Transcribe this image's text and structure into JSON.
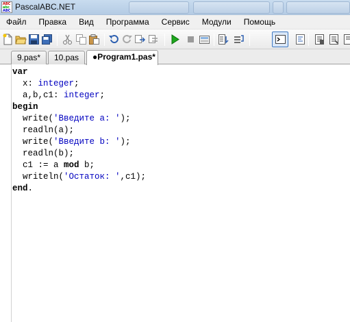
{
  "window": {
    "title": "PascalABC.NET",
    "icon_lines": [
      "ABC",
      "abc",
      "ABC"
    ]
  },
  "menu": [
    "Файл",
    "Правка",
    "Вид",
    "Программа",
    "Сервис",
    "Модули",
    "Помощь"
  ],
  "toolbar": {
    "buttons": [
      {
        "name": "new-file-icon"
      },
      {
        "name": "open-file-icon"
      },
      {
        "name": "save-icon"
      },
      {
        "name": "save-all-icon"
      },
      {
        "name": "cut-icon"
      },
      {
        "name": "copy-icon"
      },
      {
        "name": "paste-icon"
      },
      {
        "name": "undo-icon"
      },
      {
        "name": "redo-icon"
      },
      {
        "name": "find-icon"
      },
      {
        "name": "replace-icon"
      },
      {
        "name": "run-icon"
      },
      {
        "name": "stop-icon"
      },
      {
        "name": "compile-icon"
      },
      {
        "name": "step-into-icon"
      },
      {
        "name": "step-over-icon"
      },
      {
        "name": "output-window-icon"
      },
      {
        "name": "format-icon"
      },
      {
        "name": "debug-1-icon"
      },
      {
        "name": "debug-2-icon"
      },
      {
        "name": "debug-3-icon"
      }
    ],
    "active_button": "output-window-icon"
  },
  "tabs": [
    {
      "label": "9.pas*",
      "active": false
    },
    {
      "label": "10.pas",
      "active": false
    },
    {
      "label": "●Program1.pas*",
      "active": true
    }
  ],
  "editor": {
    "lines": [
      [
        {
          "t": "var",
          "c": "kw"
        }
      ],
      [
        {
          "t": "  x: ",
          "c": ""
        },
        {
          "t": "integer",
          "c": "type"
        },
        {
          "t": ";",
          "c": ""
        }
      ],
      [
        {
          "t": "  a,b,c1: ",
          "c": ""
        },
        {
          "t": "integer",
          "c": "type"
        },
        {
          "t": ";",
          "c": ""
        }
      ],
      [
        {
          "t": "begin",
          "c": "kw"
        }
      ],
      [
        {
          "t": "  write(",
          "c": ""
        },
        {
          "t": "'Введите a: '",
          "c": "str"
        },
        {
          "t": ");",
          "c": ""
        }
      ],
      [
        {
          "t": "  readln(a);",
          "c": ""
        }
      ],
      [
        {
          "t": "  write(",
          "c": ""
        },
        {
          "t": "'Введите b: '",
          "c": "str"
        },
        {
          "t": ");",
          "c": ""
        }
      ],
      [
        {
          "t": "  readln(b);",
          "c": ""
        }
      ],
      [
        {
          "t": "  c1 := a ",
          "c": ""
        },
        {
          "t": "mod",
          "c": "kw"
        },
        {
          "t": " b;",
          "c": ""
        }
      ],
      [
        {
          "t": "  writeln(",
          "c": ""
        },
        {
          "t": "'Остаток: '",
          "c": "str"
        },
        {
          "t": ",c1);",
          "c": ""
        }
      ],
      [
        {
          "t": "end",
          "c": "kw"
        },
        {
          "t": ".",
          "c": ""
        }
      ]
    ]
  }
}
